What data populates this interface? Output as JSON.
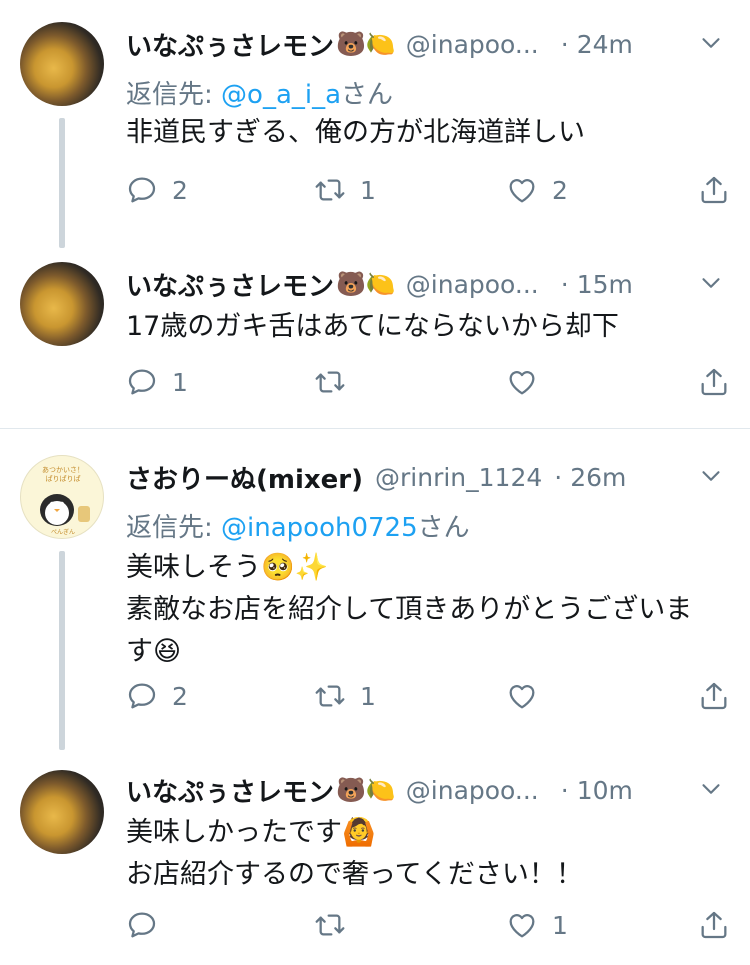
{
  "tweets": [
    {
      "name": "いなぷぅさレモン",
      "emoji": "🐻🍋",
      "handle": "@inapoo...",
      "time": "24m",
      "reply_label": "返信先:",
      "reply_mention": "@o_a_i_a",
      "reply_suffix": "さん",
      "lines": [
        "非道民すぎる、俺の方が北海道詳しい"
      ],
      "replies": "2",
      "retweets": "1",
      "likes": "2"
    },
    {
      "name": "いなぷぅさレモン",
      "emoji": "🐻🍋",
      "handle": "@inapoo...",
      "time": "15m",
      "lines": [
        "17歳のガキ舌はあてにならないから却下"
      ],
      "replies": "1",
      "retweets": "",
      "likes": ""
    },
    {
      "name": "さおりーぬ(mixer)",
      "emoji": "",
      "handle": "@rinrin_1124",
      "time": "26m",
      "reply_label": "返信先:",
      "reply_mention": "@inapooh0725",
      "reply_suffix": "さん",
      "lines": [
        "美味しそう🥺✨",
        "素敵なお店を紹介して頂きありがとうございま",
        "す😆"
      ],
      "replies": "2",
      "retweets": "1",
      "likes": ""
    },
    {
      "name": "いなぷぅさレモン",
      "emoji": "🐻🍋",
      "handle": "@inapoo...",
      "time": "10m",
      "lines": [
        "美味しかったです🙆",
        "お店紹介するので奢ってください！！"
      ],
      "replies": "",
      "retweets": "",
      "likes": "1"
    }
  ],
  "icons": {
    "reply": "reply-icon",
    "retweet": "retweet-icon",
    "like": "heart-icon",
    "share": "share-icon",
    "more": "chevron-down-icon"
  },
  "colors": {
    "text": "#14171a",
    "secondary": "#657786",
    "link": "#1da1f2",
    "thread_line": "#cdd5db",
    "divider": "#e1e8ed"
  }
}
